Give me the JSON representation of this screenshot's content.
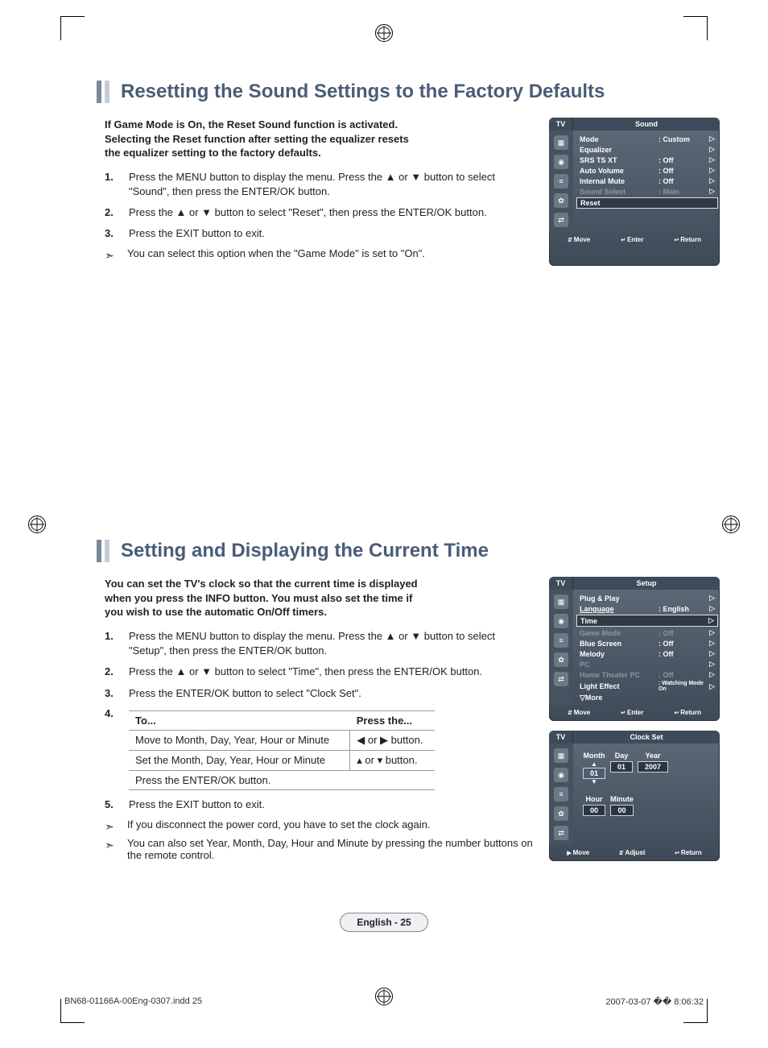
{
  "section1": {
    "title": "Resetting the Sound Settings to the Factory Defaults",
    "intro": "If Game Mode is On, the Reset Sound function is activated. Selecting the Reset function after setting the equalizer resets the equalizer setting to the factory defaults.",
    "steps": [
      "Press the MENU button to display the menu. Press the ▲ or ▼  button to select \"Sound\", then press the ENTER/OK button.",
      "Press the ▲ or ▼ button to select \"Reset\", then press the ENTER/OK button.",
      "Press the EXIT button to exit."
    ],
    "note": "You can select this option when the \"Game Mode\" is set to \"On\".",
    "osd": {
      "tv": "TV",
      "title": "Sound",
      "rows": [
        {
          "label": "Mode",
          "value": ": Custom",
          "dim": false
        },
        {
          "label": "Equalizer",
          "value": "",
          "dim": false
        },
        {
          "label": "SRS TS XT",
          "value": ": Off",
          "dim": false
        },
        {
          "label": "Auto Volume",
          "value": ": Off",
          "dim": false
        },
        {
          "label": "Internal Mute",
          "value": ": Off",
          "dim": false
        },
        {
          "label": "Sound Select",
          "value": ": Main",
          "dim": true
        },
        {
          "label": "Reset",
          "value": "",
          "hl": true
        }
      ],
      "footer": {
        "move": "Move",
        "enter": "Enter",
        "ret": "Return"
      }
    }
  },
  "section2": {
    "title": "Setting and Displaying the Current Time",
    "intro": "You can set the TV's clock so that the current time is displayed when you press the INFO button. You must also set the time if you wish to use the automatic On/Off timers.",
    "steps123": [
      "Press the MENU button to display the menu. Press the ▲ or ▼ button to select \"Setup\", then press the ENTER/OK button.",
      "Press the ▲ or ▼ button to select \"Time\", then press the ENTER/OK button.",
      "Press the ENTER/OK button to select \"Clock Set\"."
    ],
    "step4num": "4.",
    "table": {
      "head": {
        "c1": "To...",
        "c2": "Press the..."
      },
      "rows": [
        {
          "c1": "Move to Month, Day, Year, Hour or Minute",
          "c2": "◀  or  ▶  button."
        },
        {
          "c1": "Set the Month, Day, Year, Hour or Minute",
          "c2": "▴  or  ▾  button."
        },
        {
          "c1": "Press the ENTER/OK button.",
          "c2": ""
        }
      ]
    },
    "step5num": "5.",
    "step5": "Press the EXIT button to exit.",
    "notes": [
      "If you disconnect the power cord, you have to set the clock again.",
      "You can also set Year, Month, Day, Hour and Minute by pressing the number buttons on the remote control."
    ],
    "osd_setup": {
      "tv": "TV",
      "title": "Setup",
      "rows": [
        {
          "label": "Plug & Play",
          "value": "",
          "dim": false
        },
        {
          "label": "Language",
          "value": ": English",
          "dim": false,
          "ul": true
        },
        {
          "label": "Time",
          "value": "",
          "hl": true
        },
        {
          "label": "Game Mode",
          "value": ": Off",
          "dim": true
        },
        {
          "label": "Blue Screen",
          "value": ": Off",
          "dim": false
        },
        {
          "label": "Melody",
          "value": ": Off",
          "dim": false
        },
        {
          "label": "PC",
          "value": "",
          "dim": true
        },
        {
          "label": "Home Theater PC",
          "value": ": Off",
          "dim": true
        },
        {
          "label": "Light Effect",
          "value": ": Watching Mode On",
          "dim": false,
          "small": true
        },
        {
          "label": "▽More",
          "value": "",
          "dim": false
        }
      ],
      "footer": {
        "move": "Move",
        "enter": "Enter",
        "ret": "Return"
      }
    },
    "osd_clock": {
      "tv": "TV",
      "title": "Clock Set",
      "fields": [
        {
          "label": "Month",
          "value": "01",
          "sel": true
        },
        {
          "label": "Day",
          "value": "01"
        },
        {
          "label": "Year",
          "value": "2007"
        },
        {
          "label": "Hour",
          "value": "00"
        },
        {
          "label": "Minute",
          "value": "00"
        }
      ],
      "footer": {
        "move": "Move",
        "adjust": "Adjust",
        "ret": "Return"
      }
    }
  },
  "page_label": "English - 25",
  "print_footer": {
    "left": "BN68-01166A-00Eng-0307.indd   25",
    "right": "2007-03-07   �� 8:06:32"
  }
}
